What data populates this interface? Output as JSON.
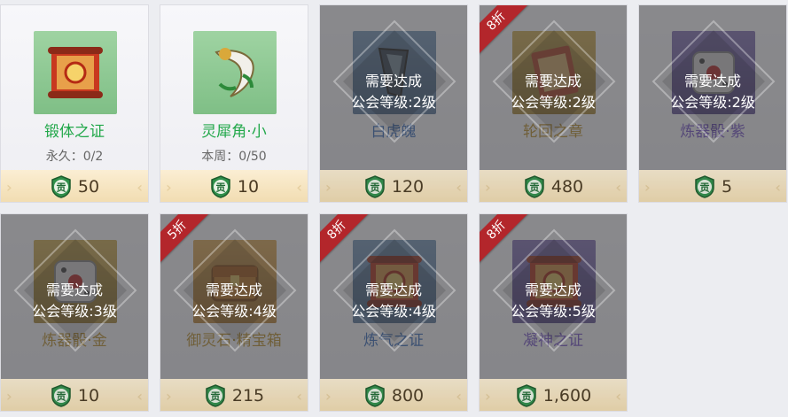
{
  "shop": {
    "items": [
      {
        "name": "锻体之证",
        "name_color": "green",
        "thumb": "green",
        "icon": "scroll-icon",
        "limit": "永久：0/2",
        "price": "50",
        "locked": false,
        "discount": ""
      },
      {
        "name": "灵犀角·小",
        "name_color": "green",
        "thumb": "green",
        "icon": "horn-icon",
        "limit": "本周：0/50",
        "price": "10",
        "locked": false,
        "discount": ""
      },
      {
        "name": "白虎魄",
        "name_color": "blue",
        "thumb": "blue",
        "icon": "claw-icon",
        "limit": "",
        "price": "120",
        "locked": true,
        "lock_line1": "需要达成",
        "lock_line2": "公会等级:2级",
        "discount": ""
      },
      {
        "name": "轮回之章",
        "name_color": "gold",
        "thumb": "gold",
        "icon": "page-icon",
        "limit": "",
        "price": "480",
        "locked": true,
        "lock_line1": "需要达成",
        "lock_line2": "公会等级:2级",
        "discount": "8折"
      },
      {
        "name": "炼器骰·紫",
        "name_color": "purple",
        "thumb": "purple",
        "icon": "dice-icon",
        "limit": "",
        "price": "5",
        "locked": true,
        "lock_line1": "需要达成",
        "lock_line2": "公会等级:2级",
        "discount": ""
      },
      {
        "name": "炼器骰·金",
        "name_color": "gold",
        "thumb": "gold",
        "icon": "dice-icon",
        "limit": "",
        "price": "10",
        "locked": true,
        "lock_line1": "需要达成",
        "lock_line2": "公会等级:3级",
        "discount": ""
      },
      {
        "name": "御灵石·精宝箱",
        "name_color": "gold",
        "thumb": "orange",
        "icon": "chest-icon",
        "limit": "",
        "price": "215",
        "locked": true,
        "lock_line1": "需要达成",
        "lock_line2": "公会等级:4级",
        "discount": "5折"
      },
      {
        "name": "炼气之证",
        "name_color": "blue",
        "thumb": "blue",
        "icon": "scroll-icon",
        "limit": "",
        "price": "800",
        "locked": true,
        "lock_line1": "需要达成",
        "lock_line2": "公会等级:4级",
        "discount": "8折"
      },
      {
        "name": "凝神之证",
        "name_color": "purple",
        "thumb": "purple",
        "icon": "scroll-icon",
        "limit": "",
        "price": "1,600",
        "locked": true,
        "lock_line1": "需要达成",
        "lock_line2": "公会等级:5级",
        "discount": "8折"
      }
    ],
    "currency_icon": "contribution-coin-icon",
    "currency_glyph": "贡"
  }
}
